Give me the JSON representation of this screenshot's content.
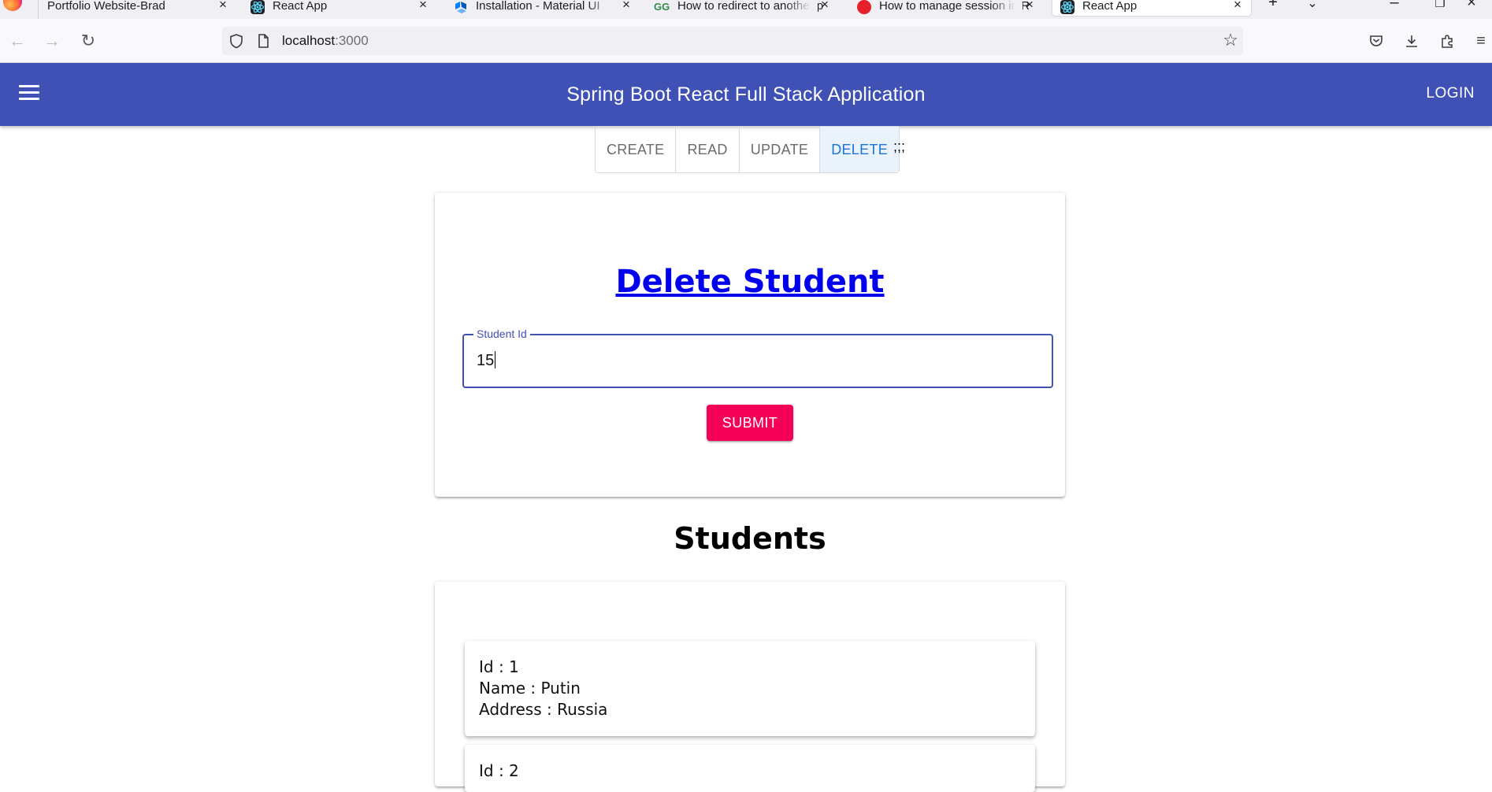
{
  "browser": {
    "tabs": [
      {
        "title": "Portfolio Website-Brad",
        "active": false
      },
      {
        "title": "React App",
        "active": false
      },
      {
        "title": "Installation - Material UI",
        "active": false
      },
      {
        "title": "How to redirect to another p",
        "active": false
      },
      {
        "title": "How to manage session in R",
        "active": false
      },
      {
        "title": "React App",
        "active": true
      }
    ],
    "url_host": "localhost",
    "url_port": ":3000"
  },
  "appbar": {
    "title": "Spring Boot React Full Stack Application",
    "login_label": "LOGIN"
  },
  "actions": {
    "create": "CREATE",
    "read": "READ",
    "update": "UPDATE",
    "delete": "DELETE",
    "selected": "DELETE",
    "trailing_text": ";;;"
  },
  "delete_form": {
    "heading": "Delete Student",
    "field_label": "Student Id",
    "field_value": "15",
    "submit_label": "SUBMIT"
  },
  "students": {
    "heading": "Students",
    "items": [
      {
        "id_line": "Id : 1",
        "name_line": "Name : Putin",
        "address_line": "Address : Russia"
      },
      {
        "id_line": "Id : 2"
      }
    ]
  },
  "colors": {
    "appbar": "#3f51b5",
    "submit": "#f50057",
    "selected_tab": "#1976d2",
    "link": "#0000ee"
  }
}
